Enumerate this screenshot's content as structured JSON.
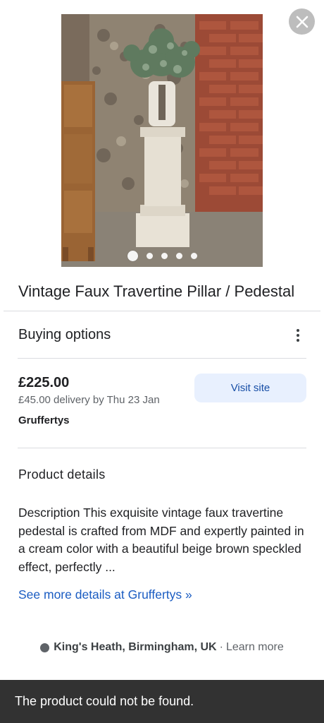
{
  "product": {
    "title": "Vintage Faux Travertine Pillar / Pedestal",
    "image_count": 5,
    "active_image_index": 0
  },
  "buying_options": {
    "heading": "Buying options",
    "more_icon": "more-vert-icon",
    "offer": {
      "price": "£225.00",
      "delivery": "£45.00 delivery by Thu 23 Jan",
      "seller": "Gruffertys",
      "visit_label": "Visit site"
    }
  },
  "details": {
    "heading": "Product details",
    "description": "Description This exquisite vintage faux travertine pedestal is crafted from MDF and expertly painted in a cream color with a beautiful beige brown speckled effect, perfectly ...",
    "more_link": "See more details at Gruffertys »"
  },
  "location": {
    "name": "King's Heath, Birmingham, UK",
    "separator": "·",
    "learn_more": "Learn more"
  },
  "snackbar": {
    "message": "The product could not be found."
  },
  "colors": {
    "link": "#1a5cc2",
    "visit_button_bg": "#e8f0fe",
    "snackbar_bg": "#323232"
  }
}
